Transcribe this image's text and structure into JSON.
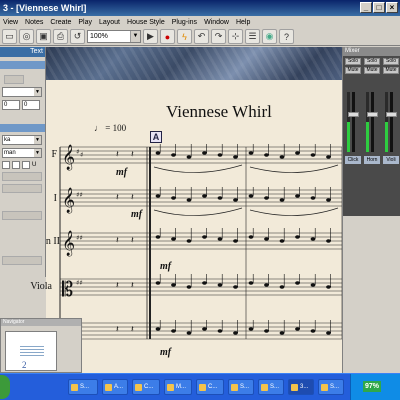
{
  "window": {
    "title": "3 - [Viennese Whirl]"
  },
  "menu": [
    "View",
    "Notes",
    "Create",
    "Play",
    "Layout",
    "House Style",
    "Plug-ins",
    "Window",
    "Help"
  ],
  "toolbar": {
    "zoom": "100%",
    "icons": [
      "new-icon",
      "open-icon",
      "save-icon",
      "print-icon",
      "navigator-icon",
      "play-icon",
      "record-icon",
      "flexi-time-icon",
      "undo-icon",
      "redo-icon",
      "properties-icon",
      "keypad-icon",
      "mixer-icon",
      "help-icon"
    ]
  },
  "left_panel": {
    "title": "Text",
    "field_value": "ka",
    "field2_value": "man",
    "num": "0",
    "num2": "0",
    "check_label": "U"
  },
  "score": {
    "title": "Viennese Whirl",
    "tempo": "♩ = 100",
    "rehearsal_mark": "A",
    "staves": [
      {
        "label": "F"
      },
      {
        "label": "I"
      },
      {
        "label": "Violin II"
      },
      {
        "label": "Viola"
      }
    ],
    "dynamics": [
      "mf",
      "mf",
      "mf",
      "mf"
    ]
  },
  "mixer": {
    "title": "Mixer",
    "channels": [
      {
        "name": "Click",
        "solo": "Solo",
        "mute": "Mute"
      },
      {
        "name": "Horn",
        "solo": "Solo",
        "mute": "Mute"
      },
      {
        "name": "Violi",
        "solo": "Solo",
        "mute": "Mute"
      }
    ]
  },
  "navigator": {
    "title": "Navigator",
    "page": "2"
  },
  "taskbar": {
    "tasks": [
      "S...",
      "A...",
      "C...",
      "M...",
      "C...",
      "S...",
      "S...",
      "3...",
      "S..."
    ],
    "battery": "97%"
  }
}
